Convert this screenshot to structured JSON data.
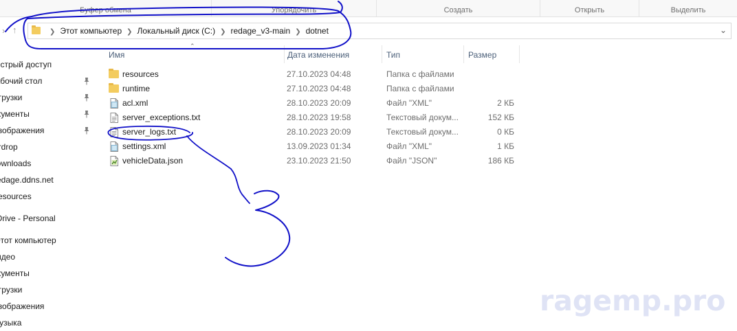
{
  "ribbon": {
    "groups": [
      {
        "label": "Буфер обмена"
      },
      {
        "label": "Упорядочить"
      },
      {
        "label": "Создать"
      },
      {
        "label": "Открыть"
      },
      {
        "label": "Выделить"
      }
    ]
  },
  "navigation": {
    "back_icon": "close-icon",
    "up_icon": "arrow-up-icon"
  },
  "address": {
    "crumbs": [
      {
        "label": "Этот компьютер"
      },
      {
        "label": "Локальный диск (C:)"
      },
      {
        "label": "redage_v3-main"
      },
      {
        "label": "dotnet"
      }
    ],
    "dropdown_icon": "chevron-down-icon"
  },
  "sidebar": {
    "items": [
      {
        "label": "Быстрый доступ",
        "pinned": false
      },
      {
        "label": "Рабочий стол",
        "pinned": true
      },
      {
        "label": "Загрузки",
        "pinned": true
      },
      {
        "label": "Документы",
        "pinned": true
      },
      {
        "label": "Изображения",
        "pinned": true
      },
      {
        "label": "Airdrop",
        "pinned": false
      },
      {
        "label": "Downloads",
        "pinned": false
      },
      {
        "label": "redage.ddns.net",
        "pinned": false
      },
      {
        "label": "resources",
        "pinned": false
      },
      {
        "label": "OneDrive - Personal",
        "pinned": false
      },
      {
        "label": "Этот компьютер",
        "pinned": false
      },
      {
        "label": "Видео",
        "pinned": false
      },
      {
        "label": "Документы",
        "pinned": false
      },
      {
        "label": "Загрузки",
        "pinned": false
      },
      {
        "label": "Изображения",
        "pinned": false
      },
      {
        "label": "Музыка",
        "pinned": false
      }
    ]
  },
  "columns": {
    "name": "Имя",
    "date": "Дата изменения",
    "type": "Тип",
    "size": "Размер"
  },
  "files": [
    {
      "name": "resources",
      "date": "27.10.2023 04:48",
      "type": "Папка с файлами",
      "size": "",
      "icon": "folder-icon"
    },
    {
      "name": "runtime",
      "date": "27.10.2023 04:48",
      "type": "Папка с файлами",
      "size": "",
      "icon": "folder-icon"
    },
    {
      "name": "acl.xml",
      "date": "28.10.2023 20:09",
      "type": "Файл \"XML\"",
      "size": "2 КБ",
      "icon": "xml-file-icon"
    },
    {
      "name": "server_exceptions.txt",
      "date": "28.10.2023 19:58",
      "type": "Текстовый докум...",
      "size": "152 КБ",
      "icon": "text-file-icon"
    },
    {
      "name": "server_logs.txt",
      "date": "28.10.2023 20:09",
      "type": "Текстовый докум...",
      "size": "0 КБ",
      "icon": "text-file-icon"
    },
    {
      "name": "settings.xml",
      "date": "13.09.2023 01:34",
      "type": "Файл \"XML\"",
      "size": "1 КБ",
      "icon": "xml-file-icon"
    },
    {
      "name": "vehicleData.json",
      "date": "23.10.2023 21:50",
      "type": "Файл \"JSON\"",
      "size": "186 КБ",
      "icon": "json-file-icon"
    }
  ],
  "annotation": {
    "label": "3",
    "color": "#1010c8"
  },
  "watermark": {
    "text": "ragemp.pro",
    "color": "#dfe3f5"
  }
}
